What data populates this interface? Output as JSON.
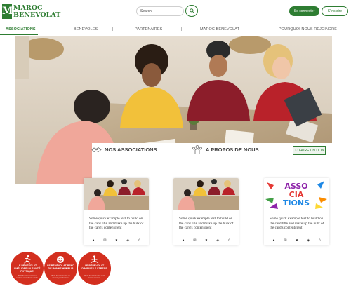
{
  "header": {
    "logo_letter": "M",
    "logo_line1": "MAROC",
    "logo_line2": "BENEVOLAT",
    "search_placeholder": "Search",
    "login_label": "Se connecter",
    "signup_label": "S'inscrire"
  },
  "nav": {
    "items": [
      {
        "label": "ASSOCIATIONS"
      },
      {
        "label": "BENEVOLES"
      },
      {
        "label": "PARTENAIRES"
      },
      {
        "label": "MAROC BENEVOLAT"
      },
      {
        "label": "POURQUOI NOUS REJOINDRE"
      }
    ],
    "separator": "|"
  },
  "sections": {
    "associations_label": "NOS ASSOCIATIONS",
    "about_label": "A PROPOS DE NOUS",
    "donate_label": "FAIRE UN DON"
  },
  "cards": [
    {
      "text": "Some quick example text to build on the card title and make up the bulk of the card's contentgient"
    },
    {
      "text": "Some quick example text to build on the card title and make up the bulk of the card's contentgient"
    },
    {
      "text": "Some quick example text to build on the card title and make up the bulk of the card's contentgient",
      "image_text": "ASSOCIATIONS"
    }
  ],
  "card_image_text": {
    "line1": "ASSO",
    "line2": "CIA",
    "line3": "TIONS"
  },
  "badges": [
    {
      "title": "LE BÉNÉVOLAT AMÉLIORE LA SANTÉ PHYSIQUE",
      "sub": "70 % des bénévoles se sentent en meilleure santé",
      "icon": "running-icon"
    },
    {
      "title": "LE BÉNÉVOLAT REND DE BONNE HUMEUR",
      "sub": "78 % des bénévoles se sentent plus heureux",
      "icon": "smiley-icon"
    },
    {
      "title": "LE BÉNÉVOLAT DIMINUE LE STRESS",
      "sub": "78 % des bénévoles sont moins stressés",
      "icon": "meditation-icon"
    }
  ],
  "colors": {
    "brand": "#2e7d32",
    "badge": "#d32f1f"
  }
}
